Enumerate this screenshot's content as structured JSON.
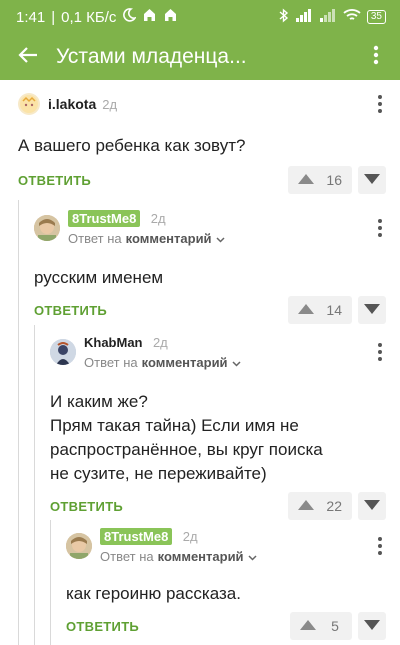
{
  "status_bar": {
    "time": "1:41",
    "speed": "0,1 КБ/с",
    "battery": "35"
  },
  "app_bar": {
    "title": "Устами младенца..."
  },
  "comments": [
    {
      "author": "i.lakota",
      "age": "2д",
      "text": "А вашего ребенка как зовут?",
      "reply_label": "ОТВЕТИТЬ",
      "votes": "16"
    },
    {
      "author": "8TrustMe8",
      "age": "2д",
      "reply_to_prefix": "Ответ на",
      "reply_to_target": "комментарий",
      "text": "русским именем",
      "reply_label": "ОТВЕТИТЬ",
      "votes": "14"
    },
    {
      "author": "KhabMan",
      "age": "2д",
      "reply_to_prefix": "Ответ на",
      "reply_to_target": "комментарий",
      "text_line1": "И каким же?",
      "text_line2": "Прям такая тайна) Если имя не распространённое, вы круг поиска не сузите, не переживайте)",
      "reply_label": "ОТВЕТИТЬ",
      "votes": "22"
    },
    {
      "author": "8TrustMe8",
      "age": "2д",
      "reply_to_prefix": "Ответ на",
      "reply_to_target": "комментарий",
      "text": "как героиню рассказа.",
      "reply_label": "ОТВЕТИТЬ",
      "votes": "5"
    }
  ],
  "colors": {
    "brand": "#7fb34a",
    "accent_green": "#5fa033"
  }
}
